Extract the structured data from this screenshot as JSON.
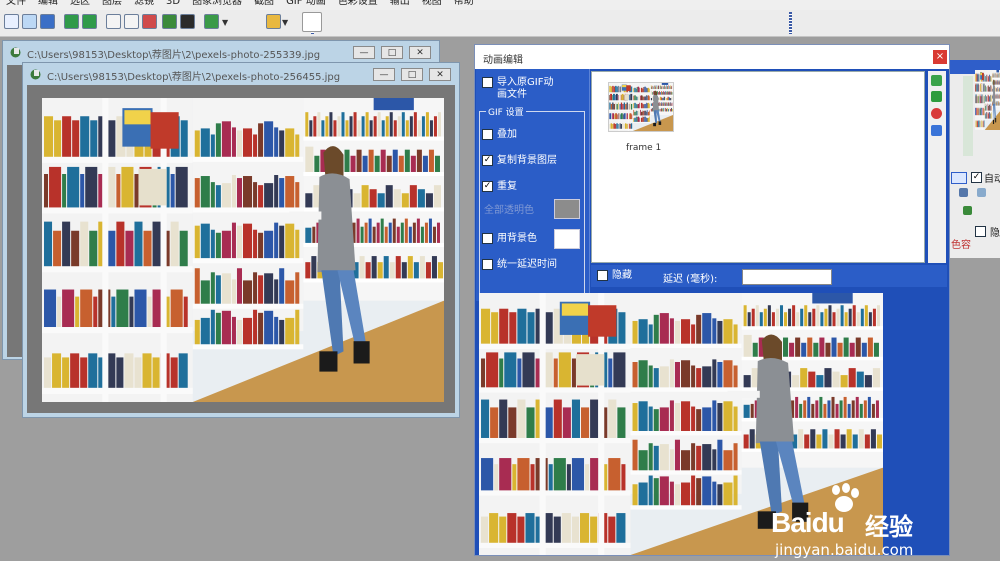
{
  "menubar": {
    "items": [
      "文件",
      "编辑",
      "选区",
      "图层",
      "滤镜",
      "3D",
      "图象浏览器",
      "截图",
      "GIF 动画",
      "色彩设置",
      "输出",
      "视图",
      "帮助"
    ]
  },
  "toolbar": {
    "icons": [
      "new-file-icon",
      "open-file-icon",
      "save-icon",
      "undo-icon",
      "redo-icon",
      "crop-icon",
      "copy-icon",
      "image-icon",
      "gallery-icon",
      "print-icon",
      "effect-icon",
      "zoom-icon"
    ]
  },
  "window_back": {
    "title": "C:\\Users\\98153\\Desktop\\荐图片\\2\\pexels-photo-255339.jpg"
  },
  "window_front": {
    "title": "C:\\Users\\98153\\Desktop\\荐图片\\2\\pexels-photo-256455.jpg"
  },
  "controls": {
    "minimize": "—",
    "maximize": "□",
    "close": "✕"
  },
  "dialog": {
    "title": "动画编辑",
    "close": "×",
    "import_gif": "导入原GIF动画文件",
    "gif_settings": "GIF 设置",
    "overlay": "叠加",
    "copy_bg_layer": "复制背景图层",
    "repeat": "重复",
    "all_transparent": "全部透明色",
    "use_bg_color": "用背景色",
    "unify_delay": "统一延迟时间",
    "hide": "隐藏",
    "delay_label": "延迟 (毫秒):",
    "frame_label": "frame 1",
    "checked": {
      "overlay": false,
      "copy_bg_layer": true,
      "repeat": true,
      "use_bg_color": false,
      "unify_delay": false,
      "hide": false,
      "import_gif": false
    }
  },
  "right_panel": {
    "auto": "自动",
    "hide": "隐藏",
    "content": "色容"
  },
  "watermark": {
    "brand": "Baidu",
    "brand_cn": "经验",
    "url": "jingyan.baidu.com"
  },
  "colors": {
    "dialog_blue": "#1f4fb8",
    "panel_blue": "#2b5dc7",
    "window_frame": "#bcd4e6",
    "workspace": "#9e9e9e",
    "close_red": "#d93a33"
  }
}
